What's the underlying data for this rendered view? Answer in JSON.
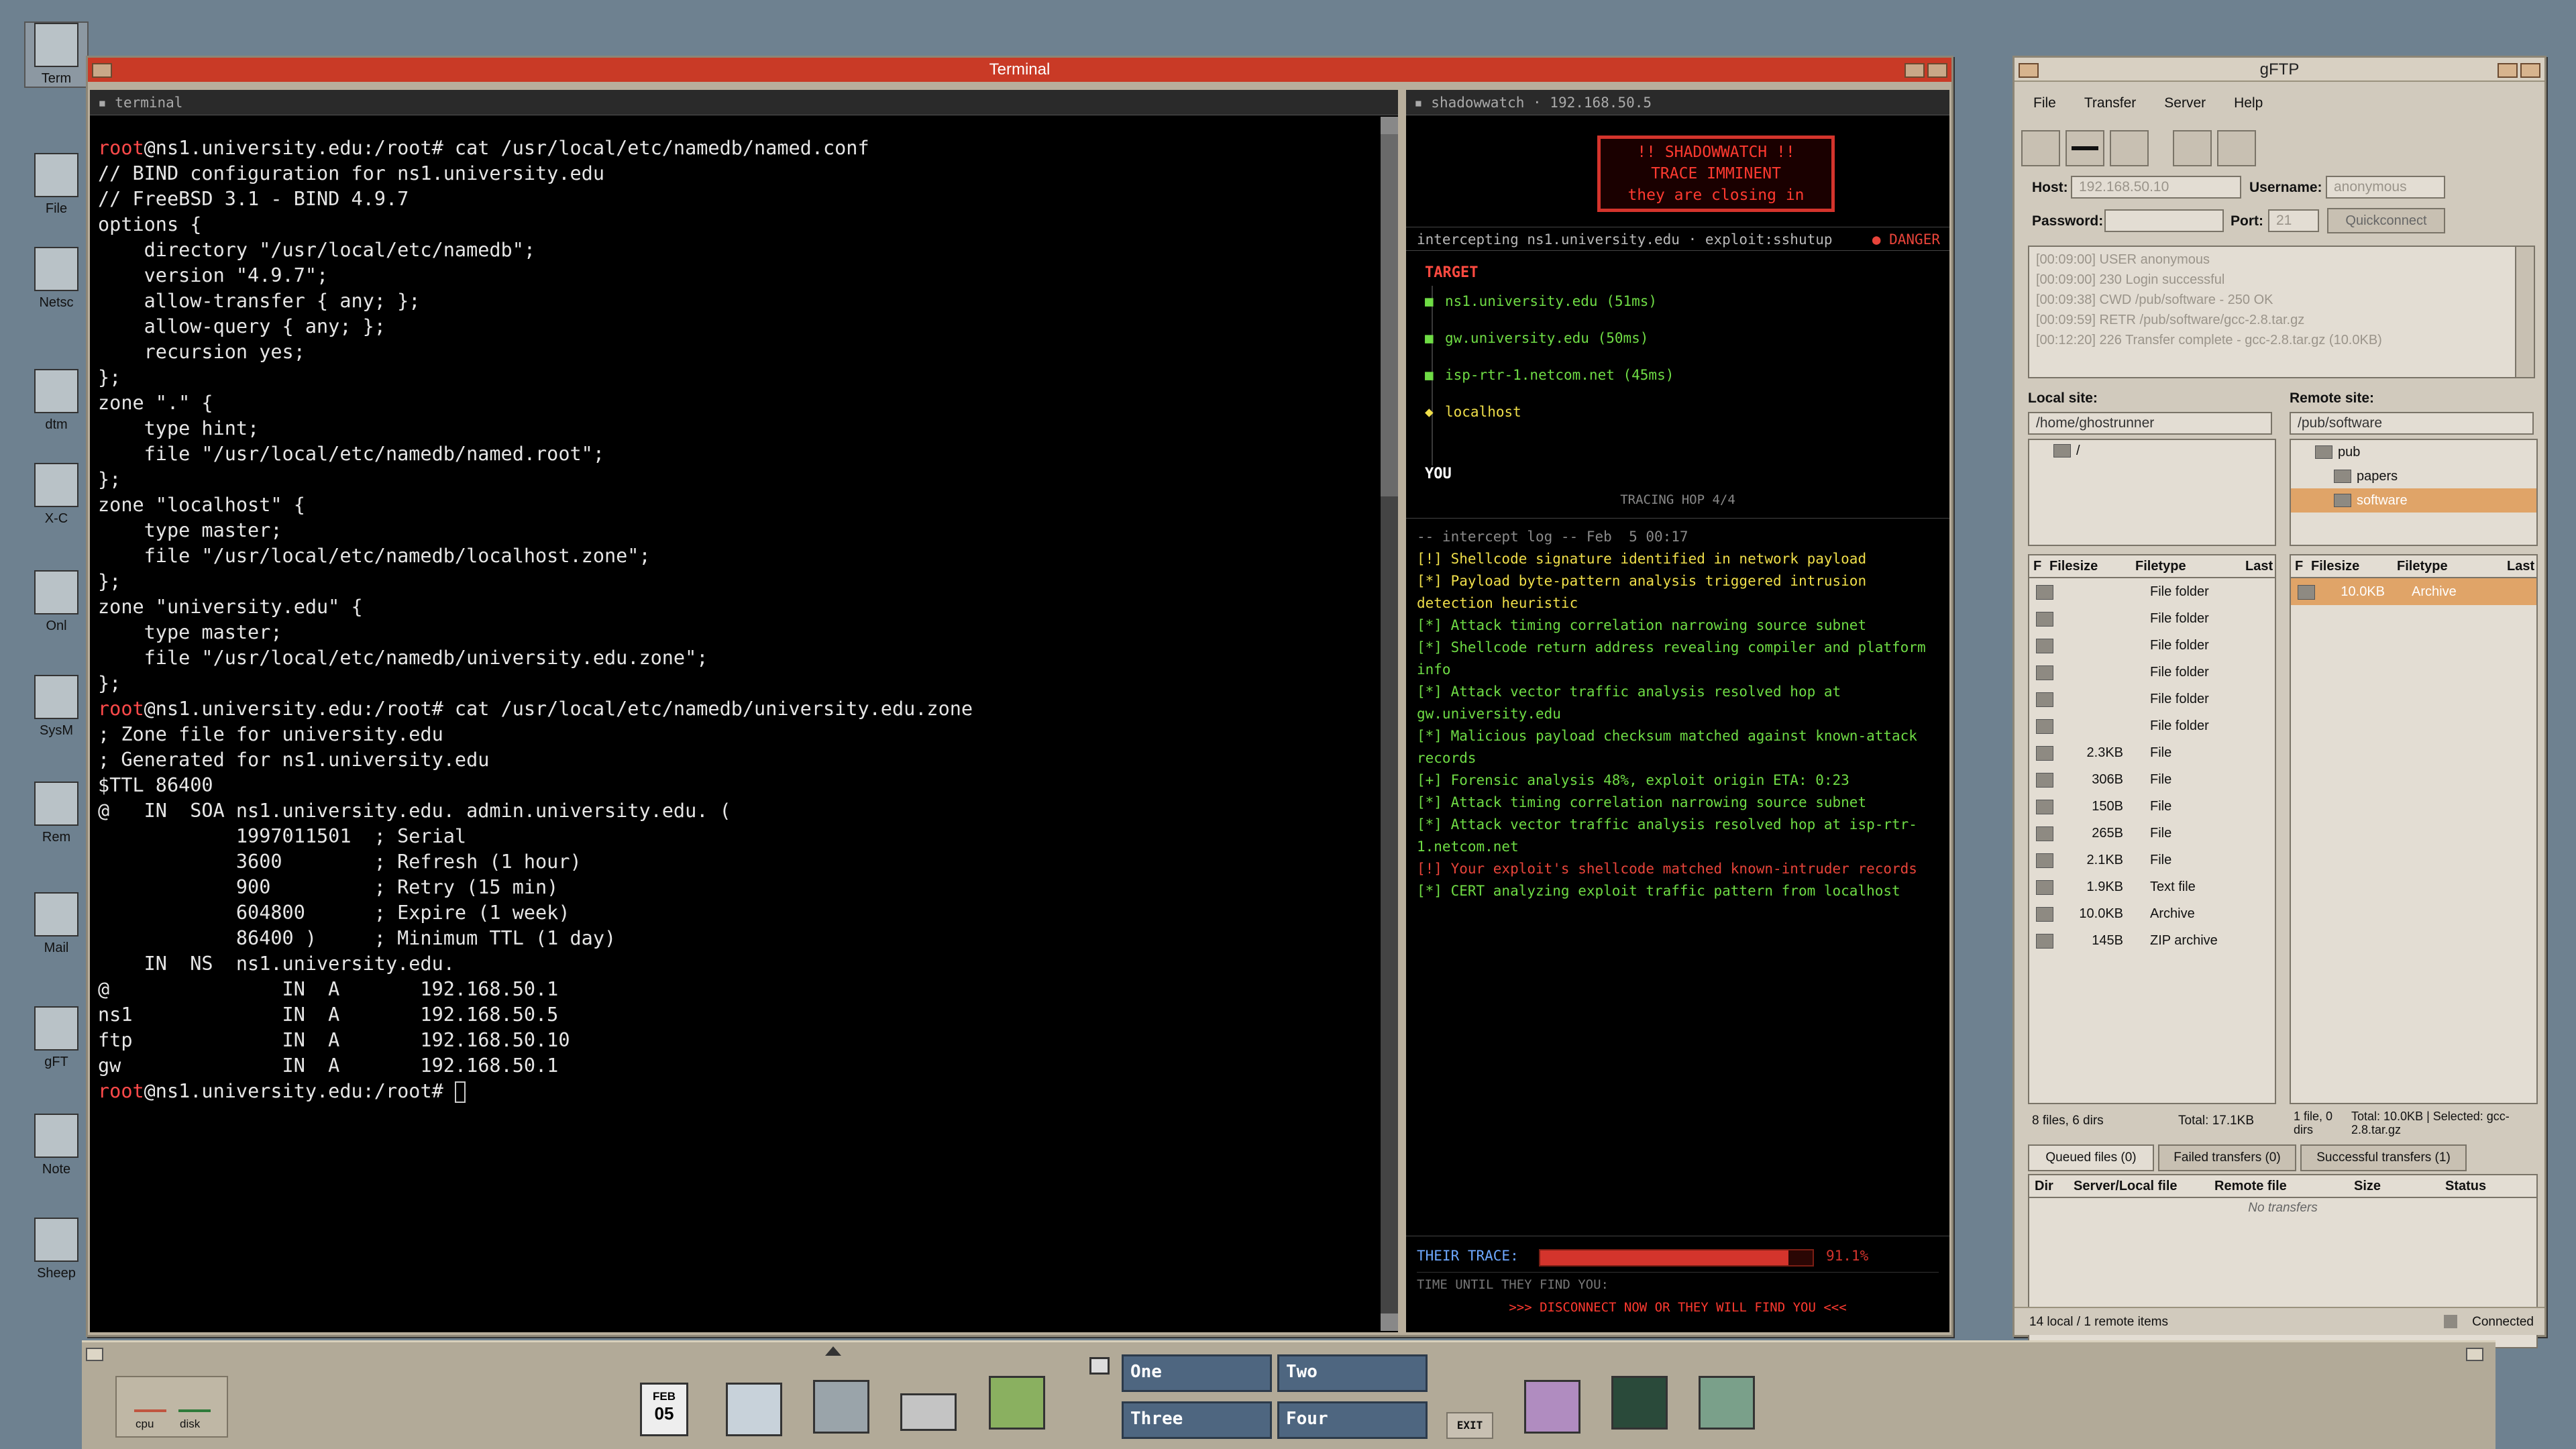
{
  "desktop": {
    "icons": [
      {
        "label": "Term"
      },
      {
        "label": "File"
      },
      {
        "label": "Netsc"
      },
      {
        "label": "dtm"
      },
      {
        "label": "X-C"
      },
      {
        "label": "Onl"
      },
      {
        "label": "SysM"
      },
      {
        "label": "Rem"
      },
      {
        "label": "Mail"
      },
      {
        "label": "gFT"
      },
      {
        "label": "Note"
      },
      {
        "label": "Sheep"
      }
    ]
  },
  "terminal_window": {
    "title": "Terminal",
    "left_tab": "terminal",
    "prompt_user": "root",
    "lines": [
      "root@ns1.university.edu:/root# cat /usr/local/etc/namedb/named.conf",
      "// BIND configuration for ns1.university.edu",
      "// FreeBSD 3.1 - BIND 4.9.7",
      "",
      "options {",
      "    directory \"/usr/local/etc/namedb\";",
      "    version \"4.9.7\";",
      "    allow-transfer { any; };",
      "    allow-query { any; };",
      "    recursion yes;",
      "};",
      "",
      "zone \".\" {",
      "    type hint;",
      "    file \"/usr/local/etc/namedb/named.root\";",
      "};",
      "",
      "zone \"localhost\" {",
      "    type master;",
      "    file \"/usr/local/etc/namedb/localhost.zone\";",
      "};",
      "",
      "zone \"university.edu\" {",
      "    type master;",
      "    file \"/usr/local/etc/namedb/university.edu.zone\";",
      "};",
      "",
      "root@ns1.university.edu:/root# cat /usr/local/etc/namedb/university.edu.zone",
      "; Zone file for university.edu",
      "; Generated for ns1.university.edu",
      "$TTL 86400",
      "@   IN  SOA ns1.university.edu. admin.university.edu. (",
      "            1997011501  ; Serial",
      "            3600        ; Refresh (1 hour)",
      "            900         ; Retry (15 min)",
      "            604800      ; Expire (1 week)",
      "            86400 )     ; Minimum TTL (1 day)",
      "",
      "    IN  NS  ns1.university.edu.",
      "",
      "@               IN  A       192.168.50.1",
      "ns1             IN  A       192.168.50.5",
      "ftp             IN  A       192.168.50.10",
      "gw              IN  A       192.168.50.1",
      "",
      "root@ns1.university.edu:/root# "
    ]
  },
  "shadowwatch": {
    "tab": "shadowwatch · 192.168.50.5",
    "alert": [
      "!! SHADOWWATCH !!",
      "TRACE IMMINENT",
      "they are closing in"
    ],
    "status_left": "intercepting ns1.university.edu · exploit:sshutup",
    "status_right": "● DANGER",
    "target_label": "TARGET",
    "hops": [
      {
        "marker": "■",
        "text": "ns1.university.edu (51ms)"
      },
      {
        "marker": "■",
        "text": "gw.university.edu (50ms)"
      },
      {
        "marker": "■",
        "text": "isp-rtr-1.netcom.net (45ms)"
      },
      {
        "marker": "◆",
        "text": "localhost"
      }
    ],
    "you_label": "YOU",
    "tracing": "TRACING HOP 4/4",
    "log_header": "-- intercept log -- Feb  5 00:17",
    "log": [
      {
        "text": "[!] Shellcode signature identified in network payload",
        "level": "warn"
      },
      {
        "text": "[*] Payload byte-pattern analysis triggered intrusion detection heuristic",
        "level": "warn"
      },
      {
        "text": "[*] Attack timing correlation narrowing source subnet",
        "level": "info"
      },
      {
        "text": "[*] Shellcode return address revealing compiler and platform info",
        "level": "info"
      },
      {
        "text": "[*] Attack vector traffic analysis resolved hop at gw.university.edu",
        "level": "info"
      },
      {
        "text": "[*] Malicious payload checksum matched against known-attack records",
        "level": "info"
      },
      {
        "text": "[+] Forensic analysis 48%, exploit origin ETA: 0:23",
        "level": "info"
      },
      {
        "text": "[*] Attack timing correlation narrowing source subnet",
        "level": "info"
      },
      {
        "text": "[*] Attack vector traffic analysis resolved hop at isp-rtr-1.netcom.net",
        "level": "info"
      },
      {
        "text": "[!] Your exploit's shellcode matched known-intruder records",
        "level": "danger"
      },
      {
        "text": "[*] CERT analyzing exploit traffic pattern from localhost",
        "level": "info"
      }
    ],
    "trace_label": "THEIR TRACE:",
    "trace_percent": "91.1%",
    "trace_fraction": 0.911,
    "time_label": "TIME UNTIL THEY FIND YOU:",
    "disconnect": ">>> DISCONNECT NOW OR THEY WILL FIND YOU <<<"
  },
  "gftp": {
    "title": "gFTP",
    "menu": [
      "File",
      "Transfer",
      "Server",
      "Help"
    ],
    "host_label": "Host:",
    "host_value": "192.168.50.10",
    "username_label": "Username:",
    "username_value": "anonymous",
    "password_label": "Password:",
    "port_label": "Port:",
    "port_value": "21",
    "quickconnect": "Quickconnect",
    "log": [
      "[00:09:00] USER anonymous",
      "[00:09:00] 230 Login successful",
      "[00:09:38] CWD /pub/software - 250 OK",
      "[00:09:59] RETR /pub/software/gcc-2.8.tar.gz",
      "[00:12:20] 226 Transfer complete - gcc-2.8.tar.gz (10.0KB)"
    ],
    "local_site_label": "Local site:",
    "local_path": "/home/ghostrunner",
    "local_tree": "/",
    "remote_site_label": "Remote site:",
    "remote_path": "/pub/software",
    "remote_tree": [
      "pub",
      "papers",
      "software"
    ],
    "col_f": "F",
    "col_filesize": "Filesize",
    "col_filetype": "Filetype",
    "col_last": "Last r",
    "local_files": [
      {
        "size": "",
        "type": "File folder"
      },
      {
        "size": "",
        "type": "File folder"
      },
      {
        "size": "",
        "type": "File folder"
      },
      {
        "size": "",
        "type": "File folder"
      },
      {
        "size": "",
        "type": "File folder"
      },
      {
        "size": "",
        "type": "File folder"
      },
      {
        "size": "2.3KB",
        "type": "File"
      },
      {
        "size": "306B",
        "type": "File"
      },
      {
        "size": "150B",
        "type": "File"
      },
      {
        "size": "265B",
        "type": "File"
      },
      {
        "size": "2.1KB",
        "type": "File"
      },
      {
        "size": "1.9KB",
        "type": "Text file"
      },
      {
        "size": "10.0KB",
        "type": "Archive"
      },
      {
        "size": "145B",
        "type": "ZIP archive"
      }
    ],
    "remote_files": [
      {
        "size": "10.0KB",
        "type": "Archive"
      }
    ],
    "local_status": "8 files, 6 dirs",
    "local_total": "Total: 17.1KB",
    "remote_status": "1 file, 0 dirs",
    "remote_total": "Total: 10.0KB | Selected: gcc-2.8.tar.gz",
    "queue_tabs": [
      "Queued files (0)",
      "Failed transfers (0)",
      "Successful transfers (1)"
    ],
    "queue_cols": [
      "Dir",
      "Server/Local file",
      "Remote file",
      "Size",
      "Status"
    ],
    "no_transfers": "No transfers",
    "footer_left": "14 local / 1 remote items",
    "footer_right": "Connected"
  },
  "taskbar": {
    "meters": [
      "cpu",
      "disk"
    ],
    "calendar_month": "FEB",
    "calendar_day": "05",
    "workspaces": [
      "One",
      "Two",
      "Three",
      "Four"
    ],
    "exit_label": "EXIT"
  },
  "colors": {
    "terminal_title": "#c93a26",
    "prompt_red": "#ff4a4a",
    "green": "#6fdc45",
    "yellow": "#f0df4a",
    "danger": "#e8443a"
  }
}
